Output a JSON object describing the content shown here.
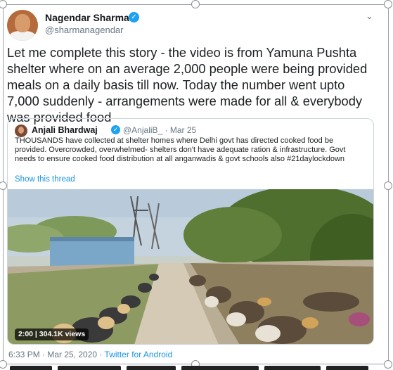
{
  "tweet": {
    "author_name": "Nagendar Sharma",
    "author_handle": "@sharmanagendar",
    "verified_mark": "✓",
    "menu_caret": "⌄",
    "text": "Let me complete this story - the video is from Yamuna Pushta shelter where on an average 2,000 people were being provided meals on a daily basis till now. Today the number went upto 7,000 suddenly - arrangements were made for all & everybody was provided food",
    "timestamp": "6:33 PM · Mar 25, 2020",
    "separator": " · ",
    "source_app": "Twitter for Android"
  },
  "quoted_tweet": {
    "author_name": "Anjali Bhardwaj",
    "verified_mark": "✓",
    "meta": "@AnjaliB_ · Mar 25",
    "text": "THOUSANDS have collected at shelter homes where Delhi govt has directed cooked food be provided. Overcrowded, overwhelmed- shelters don't have adequate ration & infrastructure. Govt needs to ensure cooked food distribution at all anganwadis & govt schools also #21daylockdown",
    "show_thread": "Show this thread",
    "video": {
      "duration": "2:00",
      "views": "304.1K views"
    }
  },
  "colors": {
    "link": "#1b95e0",
    "verified": "#1da1f2",
    "secondary_text": "#657786"
  }
}
